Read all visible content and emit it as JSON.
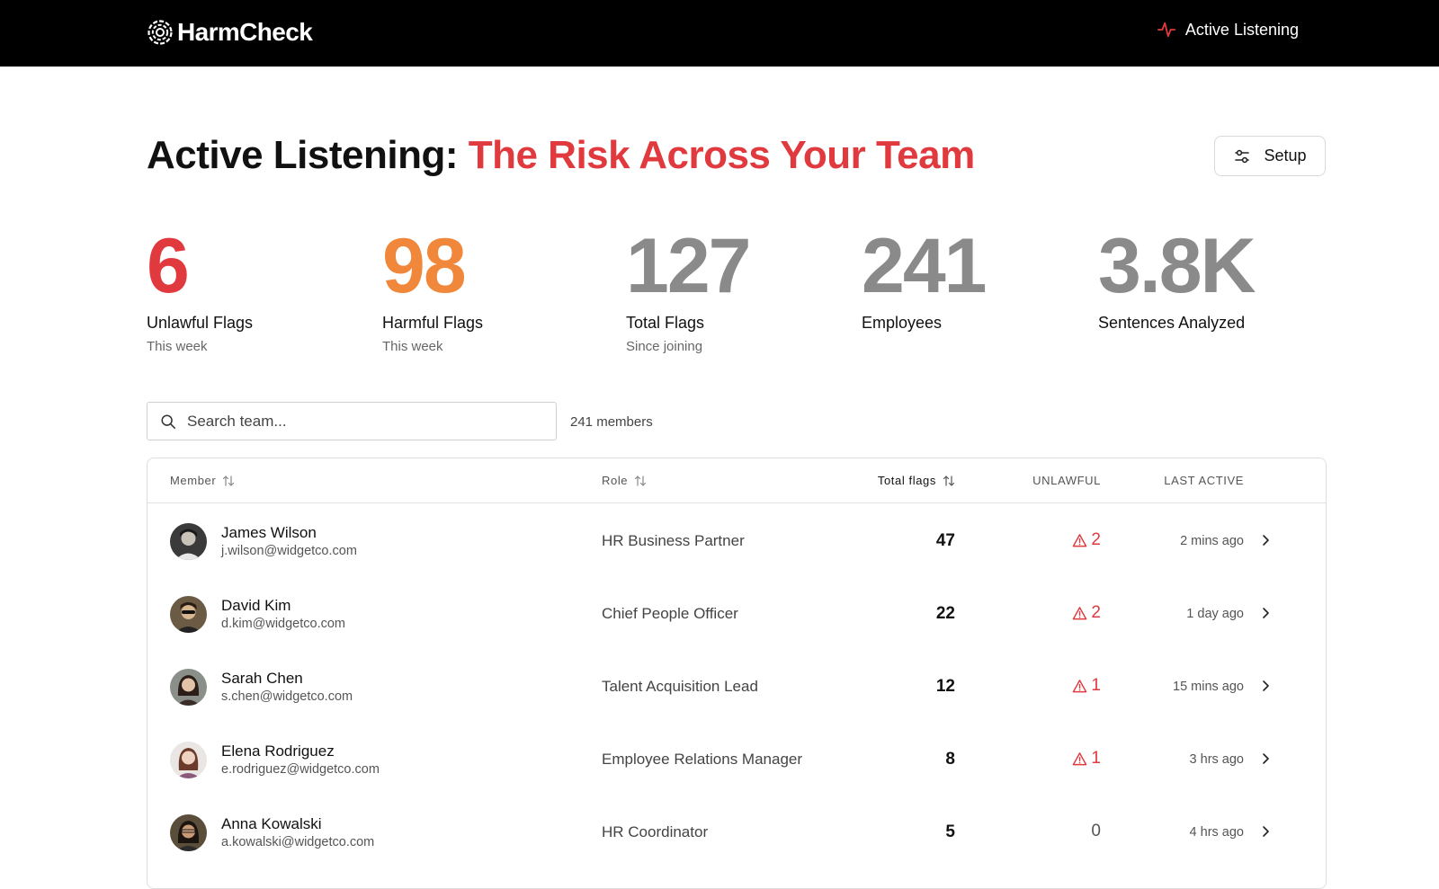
{
  "header": {
    "brand": "HarmCheck",
    "nav_active": "Active Listening"
  },
  "title": {
    "prefix": "Active Listening:",
    "accent": "The Risk Across Your Team"
  },
  "setup_button": "Setup",
  "stats": [
    {
      "value": "6",
      "label": "Unlawful Flags",
      "sub": "This week",
      "color": "#e0393e"
    },
    {
      "value": "98",
      "label": "Harmful Flags",
      "sub": "This week",
      "color": "#f0873a"
    },
    {
      "value": "127",
      "label": "Total Flags",
      "sub": "Since joining",
      "color": "#8a8a8a"
    },
    {
      "value": "241",
      "label": "Employees",
      "sub": "",
      "color": "#8a8a8a"
    },
    {
      "value": "3.8K",
      "label": "Sentences Analyzed",
      "sub": "",
      "color": "#8a8a8a"
    }
  ],
  "search": {
    "placeholder": "Search team...",
    "value": "",
    "count": "241 members"
  },
  "table": {
    "columns": {
      "member": "Member",
      "role": "Role",
      "total_flags": "Total flags",
      "unlawful": "UNLAWFUL",
      "last_active": "LAST ACTIVE"
    },
    "rows": [
      {
        "name": "James Wilson",
        "email": "j.wilson@widgetco.com",
        "role": "HR Business Partner",
        "flags": "47",
        "unlawful": "2",
        "last_active": "2 mins ago",
        "avatar": "avatar-james"
      },
      {
        "name": "David Kim",
        "email": "d.kim@widgetco.com",
        "role": "Chief People Officer",
        "flags": "22",
        "unlawful": "2",
        "last_active": "1 day ago",
        "avatar": "avatar-david"
      },
      {
        "name": "Sarah Chen",
        "email": "s.chen@widgetco.com",
        "role": "Talent Acquisition Lead",
        "flags": "12",
        "unlawful": "1",
        "last_active": "15 mins ago",
        "avatar": "avatar-sarah"
      },
      {
        "name": "Elena Rodriguez",
        "email": "e.rodriguez@widgetco.com",
        "role": "Employee Relations Manager",
        "flags": "8",
        "unlawful": "1",
        "last_active": "3 hrs ago",
        "avatar": "avatar-elena"
      },
      {
        "name": "Anna Kowalski",
        "email": "a.kowalski@widgetco.com",
        "role": "HR Coordinator",
        "flags": "5",
        "unlawful": "0",
        "last_active": "4 hrs ago",
        "avatar": "avatar-anna"
      }
    ]
  },
  "colors": {
    "accent_red": "#e0393e",
    "accent_orange": "#f0873a",
    "muted_gray": "#8a8a8a",
    "topbar": "#000000"
  }
}
